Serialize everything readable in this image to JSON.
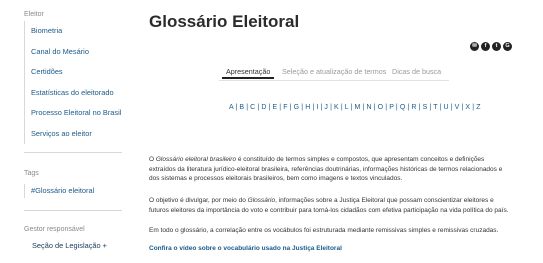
{
  "sidebar": {
    "section_title": "Eleitor",
    "items": [
      {
        "label": "Biometria"
      },
      {
        "label": "Canal do Mesário"
      },
      {
        "label": "Certidões"
      },
      {
        "label": "Estatísticas do eleitorado"
      },
      {
        "label": "Processo Eleitoral no Brasil"
      },
      {
        "label": "Serviços ao eleitor"
      }
    ],
    "tags_title": "Tags",
    "tag": "#Glossário eleitoral",
    "gestor_title": "Gestor responsável",
    "gestor_value": "Seção de Legislação +"
  },
  "main": {
    "title": "Glossário Eleitoral",
    "social_icons": [
      "email-icon",
      "facebook-icon",
      "twitter-icon",
      "google-plus-icon"
    ],
    "tabs": [
      {
        "label": "Apresentação",
        "active": true
      },
      {
        "label": "Seleção e atualização de termos",
        "active": false
      },
      {
        "label": "Dicas de busca",
        "active": false
      }
    ],
    "alphabet": "A | B | C | D | E | F | G | H | I | J | K | L | M | N | O | P | Q | R | S | T | U | V | X | Z",
    "paragraphs": {
      "p1_em": "Glossário eleitoral brasileiro",
      "p1_pre": "O ",
      "p1_rest": " é constituído de termos simples e compostos, que apresentam conceitos e definições extraídos da literatura jurídico-eleitoral brasileira, referências doutrinárias, informações históricas de termos relacionados e dos sistemas e processos eleitorais brasileiros, bem como imagens e textos vinculados.",
      "p2_pre": "O objetivo é divulgar, por meio do ",
      "p2_em": "Glossário",
      "p2_rest": ", informações sobre a Justiça Eleitoral que possam conscientizar eleitores e futuros eleitores da importância do voto e contribuir para torná-los cidadãos com efetiva participação na vida política do país.",
      "p3": "Em todo o glossário, a correlação entre os vocábulos foi estruturada mediante remissivas simples e remissivas cruzadas."
    },
    "video_link": "Confira o vídeo sobre o vocabulário usado na Justiça Eleitoral"
  }
}
